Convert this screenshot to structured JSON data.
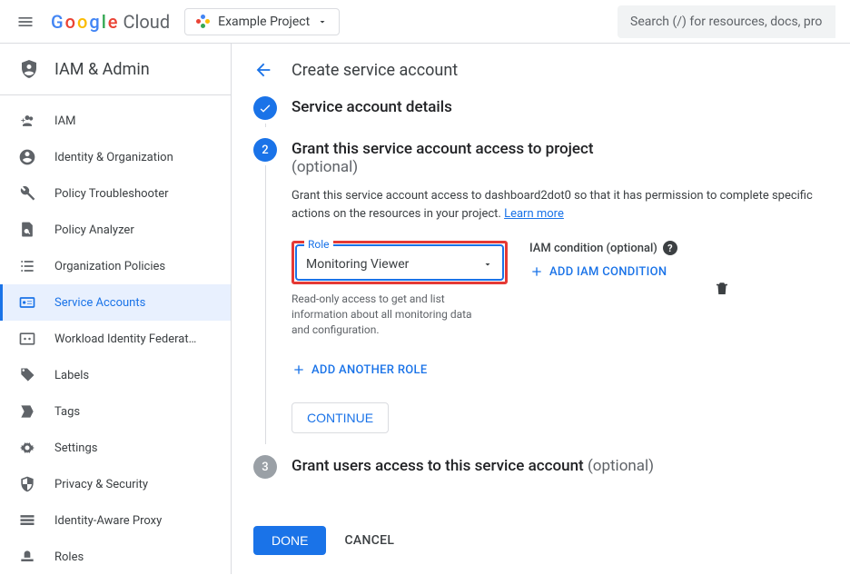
{
  "header": {
    "brand": {
      "g": "G",
      "o1": "o",
      "o2": "o",
      "g2": "g",
      "l": "l",
      "e": "e",
      "cloud": "Cloud"
    },
    "project_label": "Example Project",
    "search_placeholder": "Search (/) for resources, docs, pro"
  },
  "sidebar": {
    "title": "IAM & Admin",
    "items": [
      {
        "label": "IAM"
      },
      {
        "label": "Identity & Organization"
      },
      {
        "label": "Policy Troubleshooter"
      },
      {
        "label": "Policy Analyzer"
      },
      {
        "label": "Organization Policies"
      },
      {
        "label": "Service Accounts"
      },
      {
        "label": "Workload Identity Federat…"
      },
      {
        "label": "Labels"
      },
      {
        "label": "Tags"
      },
      {
        "label": "Settings"
      },
      {
        "label": "Privacy & Security"
      },
      {
        "label": "Identity-Aware Proxy"
      },
      {
        "label": "Roles"
      }
    ]
  },
  "page": {
    "title": "Create service account",
    "step1": {
      "title": "Service account details"
    },
    "step2": {
      "title": "Grant this service account access to project",
      "optional": "(optional)",
      "desc_a": "Grant this service account access to dashboard2dot0 so that it has permission to complete specific actions on the resources in your project. ",
      "learn": "Learn more",
      "role": {
        "label": "Role",
        "value": "Monitoring Viewer",
        "hint": "Read-only access to get and list information about all monitoring data and configuration."
      },
      "iam_cond": {
        "label": "IAM condition (optional)",
        "add": "ADD IAM CONDITION"
      },
      "add_role": "ADD ANOTHER ROLE",
      "continue": "CONTINUE"
    },
    "step3": {
      "title": "Grant users access to this service account ",
      "optional": "(optional)"
    },
    "buttons": {
      "done": "DONE",
      "cancel": "CANCEL"
    }
  }
}
